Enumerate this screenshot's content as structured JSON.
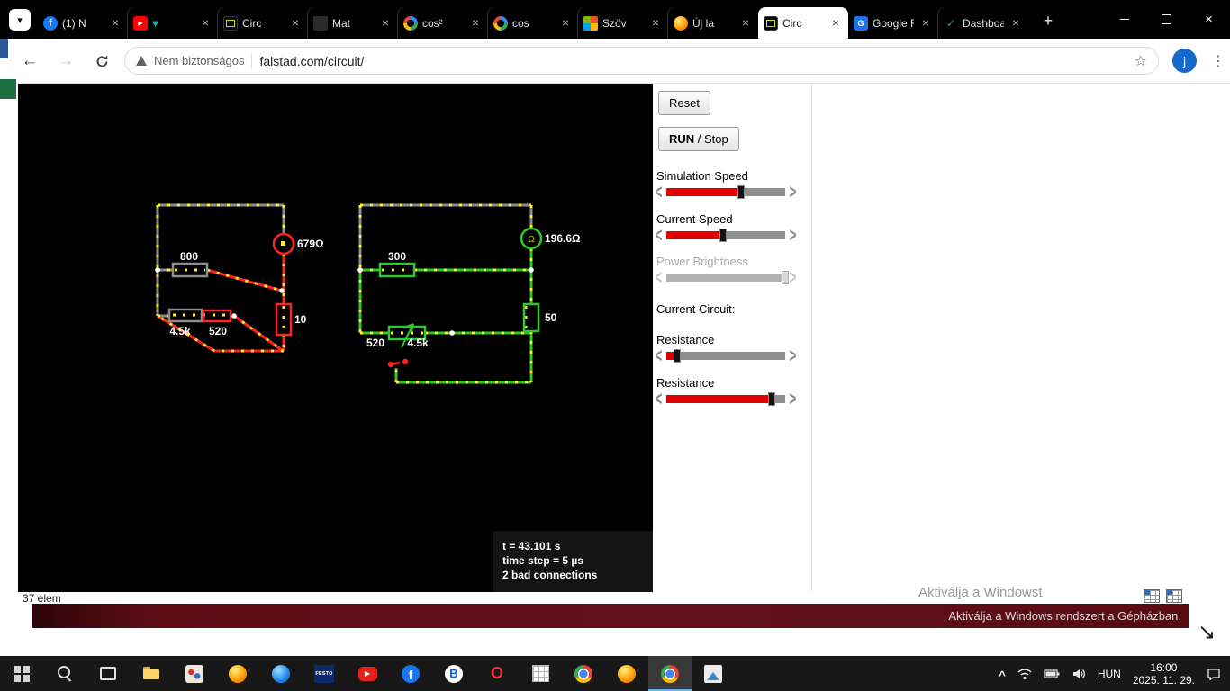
{
  "browser": {
    "tabs": [
      {
        "title": "(1) N",
        "icon": "facebook"
      },
      {
        "title": "♥",
        "icon": "youtube",
        "title_color": "#18b3a4"
      },
      {
        "title": "Circ",
        "icon": "circuit"
      },
      {
        "title": "Mat",
        "icon": "dark"
      },
      {
        "title": "cos²",
        "icon": "google"
      },
      {
        "title": "cos",
        "icon": "google"
      },
      {
        "title": "Szöv",
        "icon": "office"
      },
      {
        "title": "Új la",
        "icon": "firefox"
      },
      {
        "title": "Circ",
        "icon": "circuit",
        "active": true
      },
      {
        "title": "Google F",
        "icon": "googlef"
      },
      {
        "title": "Dashboa",
        "icon": "leaf"
      }
    ],
    "nav": {
      "security_chip": "Nem biztonságos",
      "url": "falstad.com/circuit/",
      "avatar_letter": "j"
    }
  },
  "simulator": {
    "controls": {
      "reset": "Reset",
      "run": "RUN",
      "stop": " / Stop",
      "current_circuit": "Current Circuit:",
      "sliders": [
        {
          "label": "Simulation Speed",
          "value": 0.63,
          "disabled": false
        },
        {
          "label": "Current Speed",
          "value": 0.48,
          "disabled": false
        },
        {
          "label": "Power Brightness",
          "value": 1,
          "disabled": true
        },
        {
          "label": "Resistance",
          "value": 0.09,
          "disabled": false
        },
        {
          "label": "Resistance",
          "value": 0.89,
          "disabled": false
        }
      ]
    },
    "canvas": {
      "left_circuit": {
        "r1": "800",
        "meter": "679Ω",
        "r2": "10",
        "r3": "4.5k",
        "r4": "520"
      },
      "right_circuit": {
        "r1": "300",
        "meter": "196.6Ω",
        "meter_symbol": "Ω",
        "r2": "50",
        "r3": "520",
        "r4": "4.5k"
      },
      "status": {
        "time": "t = 43.101 s",
        "step": "time step = 5 µs",
        "bad": "2 bad connections"
      }
    },
    "element_count": "37 elem"
  },
  "watermark": {
    "line1": "Aktiválja a Windowst",
    "line2": "Aktiválja a Windows rendszert a Gépházban."
  },
  "taskbar": {
    "apps": [
      {
        "name": "start",
        "glyph": ""
      },
      {
        "name": "search",
        "glyph": ""
      },
      {
        "name": "task-view",
        "glyph": ""
      },
      {
        "name": "file-explorer",
        "glyph": ""
      },
      {
        "name": "paint",
        "glyph": ""
      },
      {
        "name": "firefox",
        "glyph": ""
      },
      {
        "name": "blue-app",
        "glyph": ""
      },
      {
        "name": "festo",
        "glyph": "FESTO"
      },
      {
        "name": "youtube",
        "glyph": "▶"
      },
      {
        "name": "facebook",
        "glyph": "f"
      },
      {
        "name": "browser-b",
        "glyph": "B"
      },
      {
        "name": "opera",
        "glyph": "O"
      },
      {
        "name": "calculator",
        "glyph": ""
      },
      {
        "name": "chrome",
        "glyph": ""
      },
      {
        "name": "firefox",
        "glyph": ""
      },
      {
        "name": "chrome",
        "glyph": "",
        "active": true
      },
      {
        "name": "photos",
        "glyph": ""
      }
    ],
    "tray_icons": [
      "tray-expand",
      "network",
      "battery",
      "volume",
      "notifications"
    ],
    "language": "HUN",
    "time": "16:00",
    "date": "2025. 11. 29."
  }
}
